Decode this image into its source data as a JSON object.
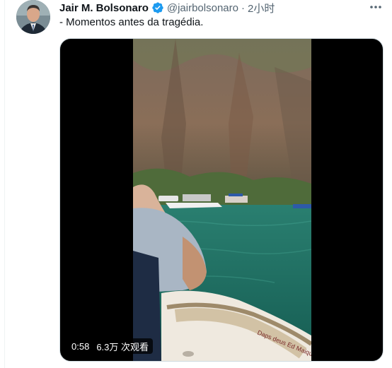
{
  "tweet": {
    "author_name": "Jair M. Bolsonaro",
    "handle": "@jairbolsonaro",
    "separator": "·",
    "timestamp": "2小时",
    "text": "- Momentos antes da tragédia.",
    "verified": true
  },
  "video": {
    "duration": "0:58",
    "views": "6.3万 次观看"
  },
  "colors": {
    "verified_badge": "#1d9bf0",
    "secondary_text": "#536471",
    "primary_text": "#0f1419",
    "water": "#1e6f63"
  },
  "icons": {
    "verified": "verified-badge-icon",
    "more": "more-options-icon"
  }
}
